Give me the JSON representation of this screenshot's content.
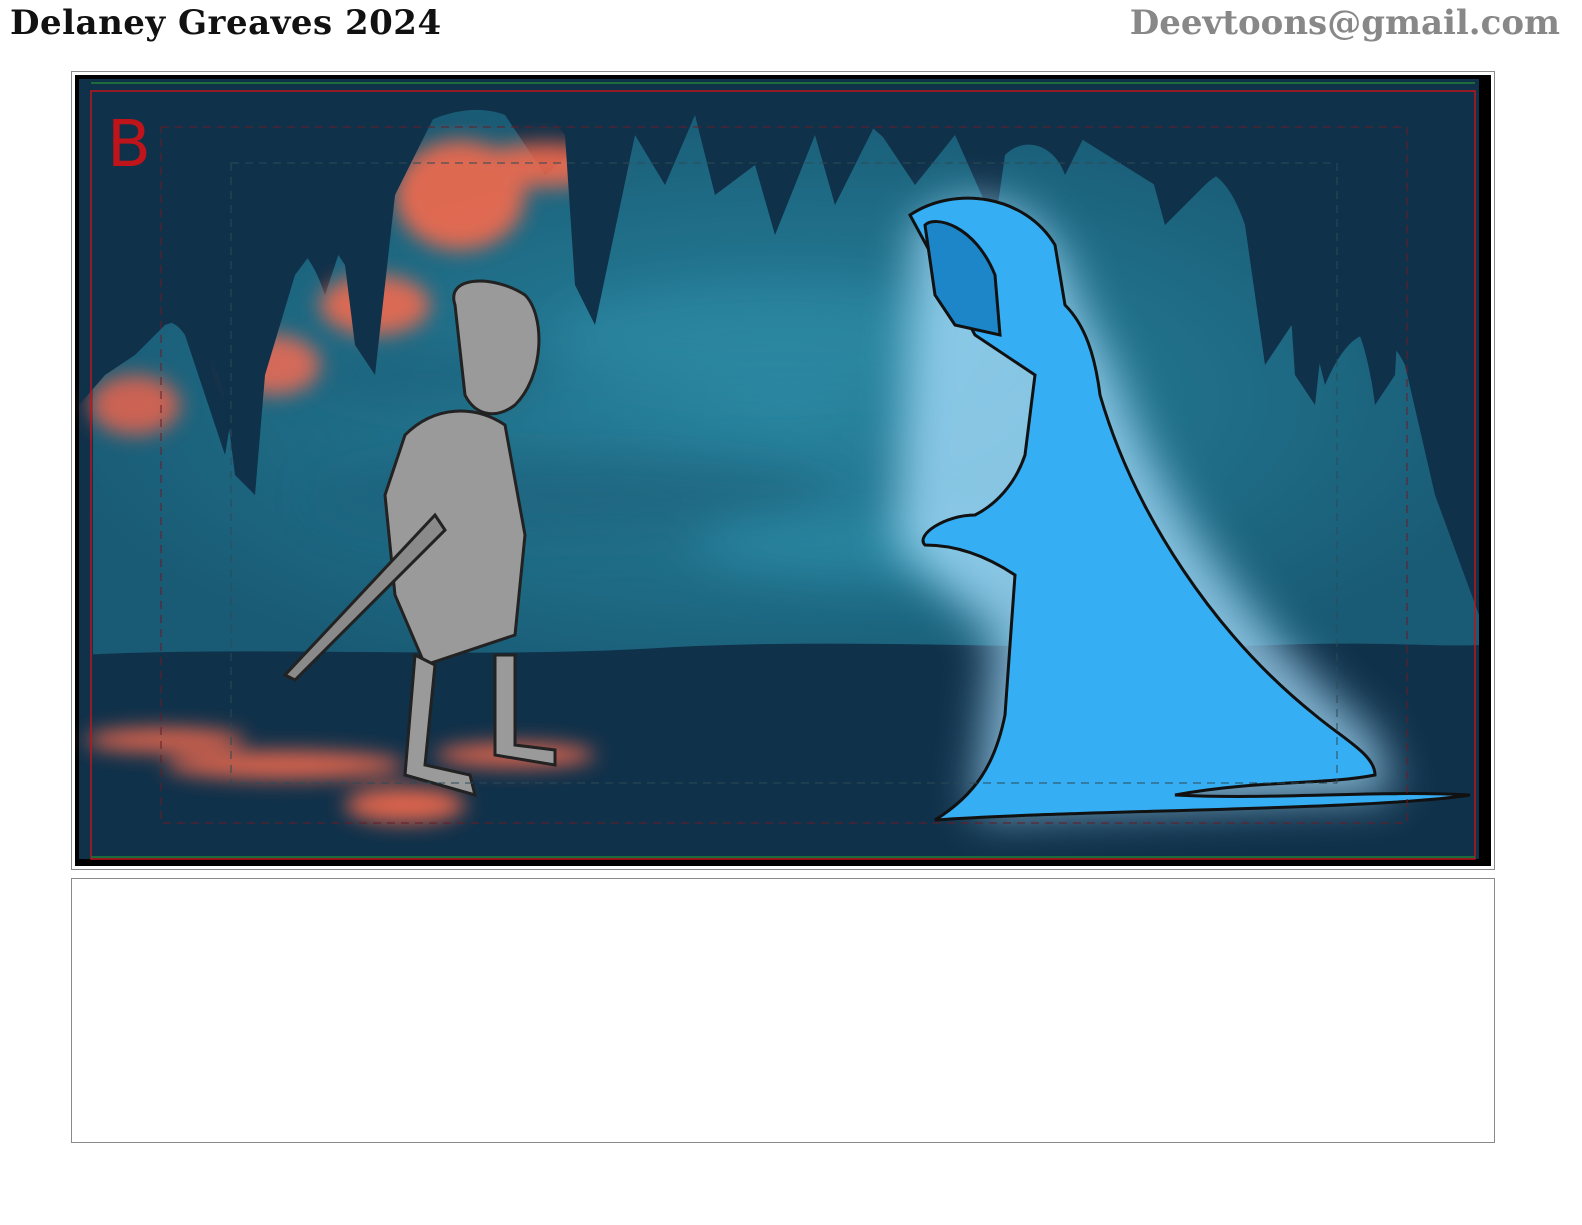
{
  "header": {
    "author_year": "Delaney Greaves 2024",
    "email": "Deevtoons@gmail.com"
  },
  "panel": {
    "label": "B"
  },
  "colors": {
    "background_dark": "#10314a",
    "cave_teal": "#1f6f86",
    "glow_orange": "#f46a4e",
    "ghost_blue": "#36aef3",
    "character_gray": "#9a9a9a",
    "safe_area_red": "#c0141b"
  },
  "notes": {
    "text": ""
  }
}
